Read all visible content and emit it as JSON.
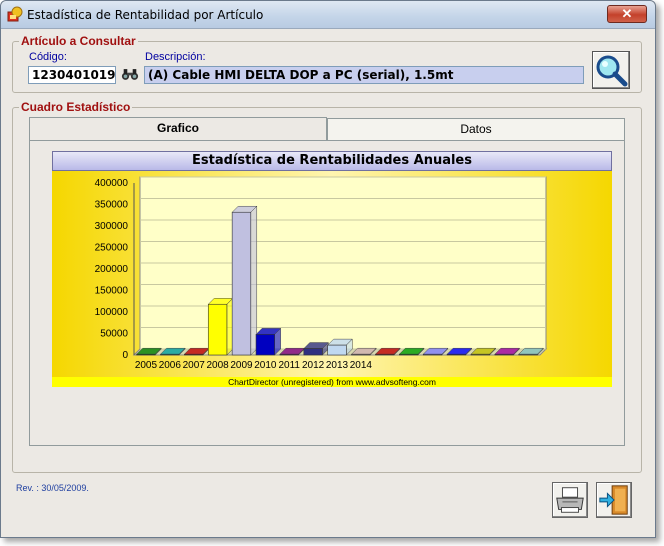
{
  "window": {
    "title": "Estadística de Rentabilidad por Artículo",
    "close_label": "✕"
  },
  "article": {
    "legend": "Artículo a Consultar",
    "code_label": "Código:",
    "code_value": "1230401019",
    "desc_label": "Descripción:",
    "desc_value": "(A) Cable HMI DELTA DOP a PC (serial), 1.5mt"
  },
  "stats": {
    "legend": "Cuadro Estadístico",
    "tabs": [
      {
        "label": "Grafico"
      },
      {
        "label": "Datos"
      }
    ]
  },
  "footer": {
    "revision": "Rev. : 30/05/2009."
  },
  "chart_data": {
    "type": "bar",
    "title": "Estadística de Rentabilidades Anuales",
    "credit": "ChartDirector (unregistered) from www.advsofteng.com",
    "categories": [
      "2005",
      "2006",
      "2007",
      "2008",
      "2009",
      "2010",
      "2011",
      "2012",
      "2013",
      "2014",
      "",
      "",
      "",
      "",
      "",
      "",
      ""
    ],
    "values": [
      0,
      0,
      0,
      118000,
      332000,
      48000,
      0,
      15000,
      23000,
      0,
      0,
      0,
      0,
      0,
      0,
      0,
      0
    ],
    "colors": [
      "#008000",
      "#00a0a0",
      "#c00000",
      "#ffff00",
      "#c0c0e0",
      "#0000c0",
      "#800080",
      "#303080",
      "#c0d8f0",
      "#d0b0b0",
      "#c00000",
      "#00a000",
      "#8080ff",
      "#0000ff",
      "#c0c000",
      "#a000a0",
      "#80c0c0"
    ],
    "yticks": [
      0,
      50000,
      100000,
      150000,
      200000,
      250000,
      300000,
      350000,
      400000
    ],
    "ylim": [
      0,
      400000
    ],
    "grid": true
  }
}
